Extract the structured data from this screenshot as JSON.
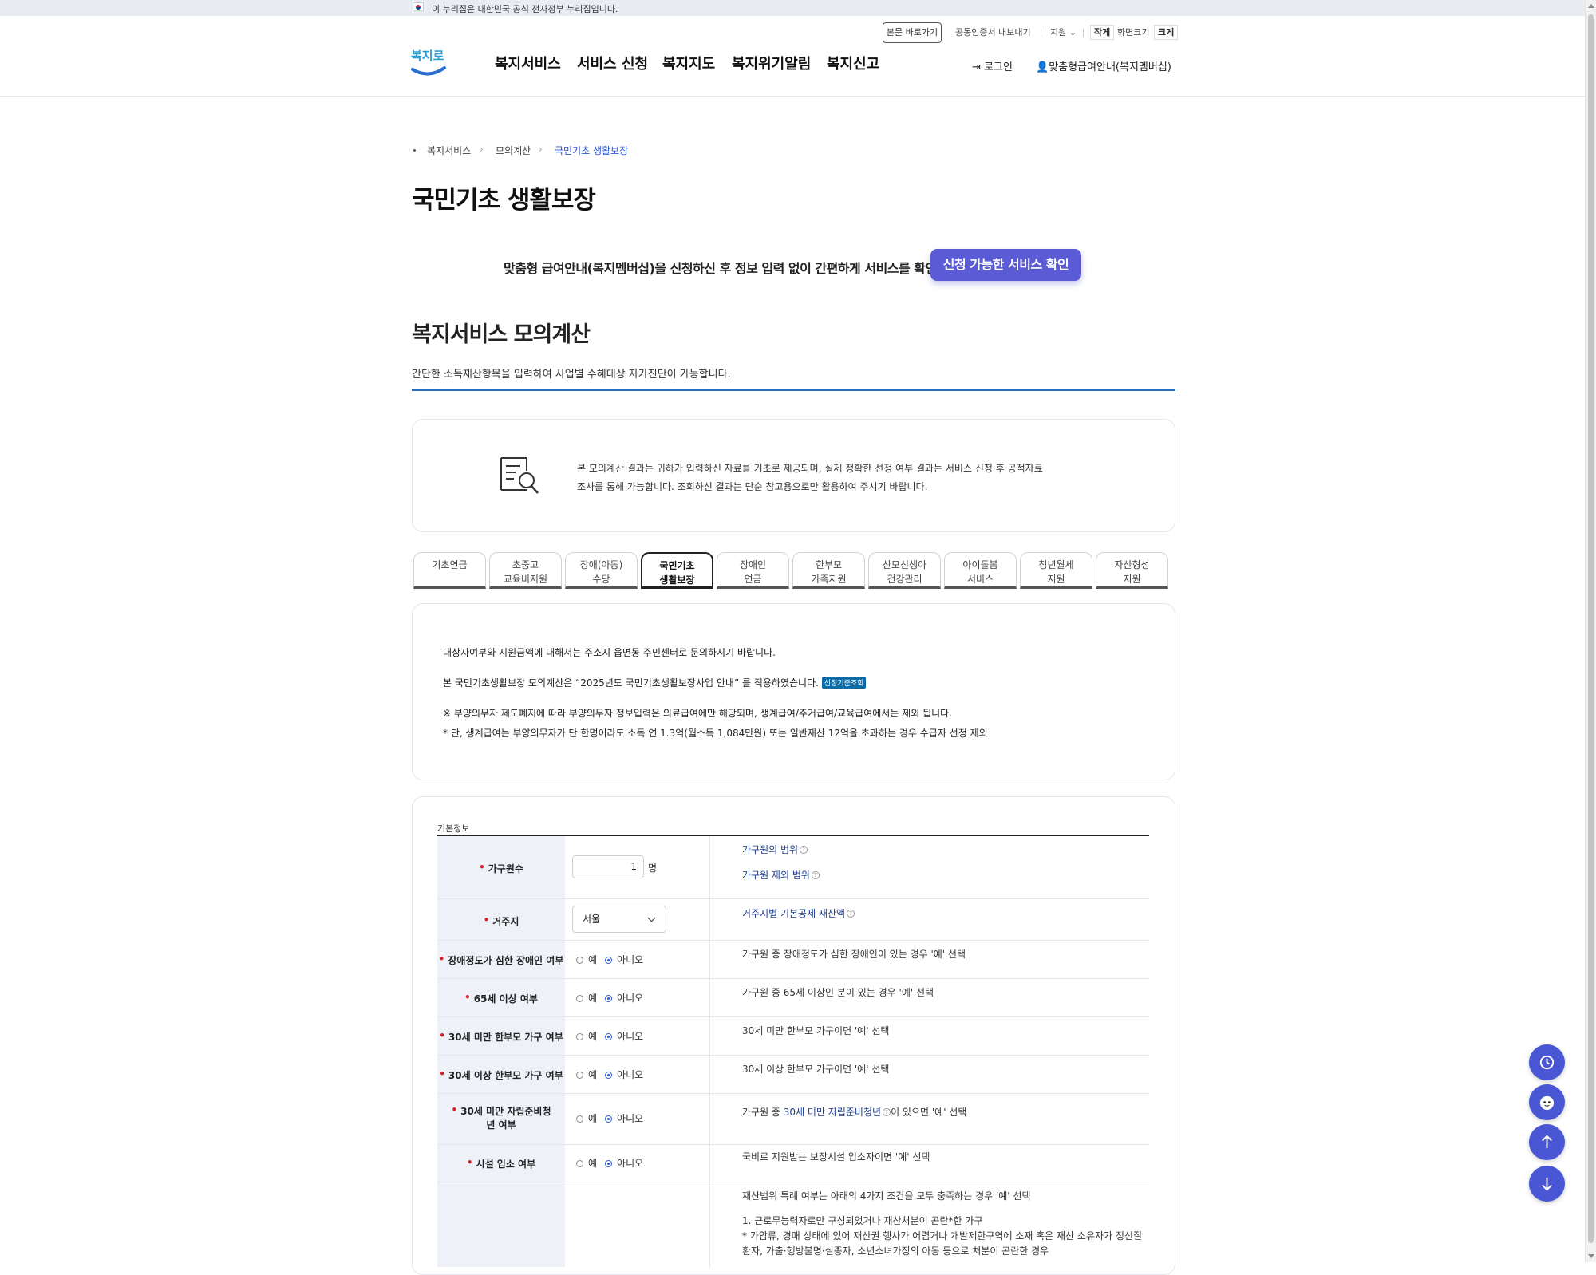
{
  "gov_banner": {
    "text": "이 누리집은 대한민국 공식 전자정부 누리집입니다."
  },
  "utility": {
    "skip": "본문 바로가기",
    "cert": "공동인증서 내보내기",
    "lang": "지원",
    "font_small": "작게",
    "font_label": "화면크기",
    "font_large": "크게"
  },
  "logo": {
    "text": "복지로"
  },
  "gnb": [
    "복지서비스",
    "서비스 신청",
    "복지지도",
    "복지위기알림",
    "복지신고"
  ],
  "header_right": {
    "login": "로그인",
    "membership": "맞춤형급여안내(복지멤버십)"
  },
  "breadcrumb": [
    "복지서비스",
    "모의계산",
    "국민기초 생활보장"
  ],
  "page_title": "국민기초 생활보장",
  "promo": {
    "text": "맞춤형 급여안내(복지멤버십)을 신청하신 후 정보 입력 없이 간편하게 서비스를 확인해보세요!",
    "button": "신청 가능한 서비스 확인"
  },
  "section": {
    "title": "복지서비스 모의계산",
    "desc": "간단한 소득재산항목을 입력하여 사업별 수혜대상 자가진단이 가능합니다."
  },
  "notice": {
    "line1": "본 모의계산 결과는 귀하가 입력하신 자료를 기초로 제공되며, 실제 정확한 선정 여부 결과는 서비스 신청 후 공적자료",
    "line2": "조사를 통해 가능합니다. 조회하신 결과는 단순 참고용으로만 활용하여 주시기 바랍니다."
  },
  "tabs": [
    {
      "l1": "기초연금",
      "l2": ""
    },
    {
      "l1": "초중고",
      "l2": "교육비지원"
    },
    {
      "l1": "장애(아동)",
      "l2": "수당"
    },
    {
      "l1": "국민기초",
      "l2": "생활보장"
    },
    {
      "l1": "장애인",
      "l2": "연금"
    },
    {
      "l1": "한부모",
      "l2": "가족지원"
    },
    {
      "l1": "산모신생아",
      "l2": "건강관리"
    },
    {
      "l1": "아이돌봄",
      "l2": "서비스"
    },
    {
      "l1": "청년월세",
      "l2": "지원"
    },
    {
      "l1": "자산형성",
      "l2": "지원"
    }
  ],
  "active_tab": 3,
  "info": {
    "line1": "대상자여부와 지원금액에 대해서는 주소지 읍면동 주민센터로 문의하시기 바랍니다.",
    "line2": "본 국민기초생활보장 모의계산은 “2025년도 국민기초생활보장사업 안내” 를 적용하였습니다.",
    "badge": "선정기준조회",
    "line3": "※ 부양의무자 제도폐지에 따라 부양의무자 정보입력은 의료급여에만 해당되며, 생계급여/주거급여/교육급여에서는 제외 됩니다.",
    "line4": "* 단, 생계급여는 부양의무자가 단 한명이라도 소득 연 1.3억(월소득 1,084만원) 또는 일반재산 12억을 초과하는 경우 수급자 선정 제외"
  },
  "form": {
    "caption": "기본정보",
    "household": {
      "label": "가구원수",
      "value": "1",
      "unit": "명",
      "link1": "가구원의 범위",
      "link2": "가구원 제외 범위"
    },
    "residence": {
      "label": "거주지",
      "value": "서울",
      "link": "거주지별 기본공제 재산액"
    },
    "yes": "예",
    "no": "아니오",
    "rows": [
      {
        "label": "장애정도가 심한 장애인 여부",
        "desc": "가구원 중 장애정도가 심한 장애인이 있는 경우 '예' 선택"
      },
      {
        "label": "65세 이상 여부",
        "desc": "가구원 중 65세 이상인 분이 있는 경우 '예' 선택"
      },
      {
        "label": "30세 미만 한부모 가구 여부",
        "desc": "30세 미만 한부모 가구이면 '예' 선택"
      },
      {
        "label": "30세 이상 한부모 가구 여부",
        "desc": "30세 이상 한부모 가구이면 '예' 선택"
      },
      {
        "label": "30세 미만 자립준비청년 여부",
        "desc_pre": "가구원 중 ",
        "desc_link": "30세 미만 자립준비청년",
        "desc_post": "이 있으면 '예' 선택"
      },
      {
        "label": "시설 입소 여부",
        "desc": "국비로 지원받는 보장시설 입소자이면 '예' 선택"
      }
    ],
    "special": {
      "line1": "재산범위 특례 여부는 아래의 4가지 조건을 모두 충족하는 경우 '예' 선택",
      "line2": "1. 근로무능력자로만 구성되었거나 재산처분이 곤란*한 가구",
      "line3": "* 가압류, 경매 상태에 있어 재산권 행사가 어렵거나 개발제한구역에 소재 혹은 재산 소유자가 정신질",
      "line4": "환자, 가출·행방불명·실종자, 소년소녀가정의 아동 등으로 처분이 곤란한 경우"
    }
  },
  "colors": {
    "accent": "#5b5bd6",
    "link": "#1f3f8f",
    "fab": "#4a57d4",
    "required": "#d3242c"
  },
  "fab_icons": [
    "history-icon",
    "chatbot-icon",
    "arrow-up-icon",
    "arrow-down-icon"
  ]
}
